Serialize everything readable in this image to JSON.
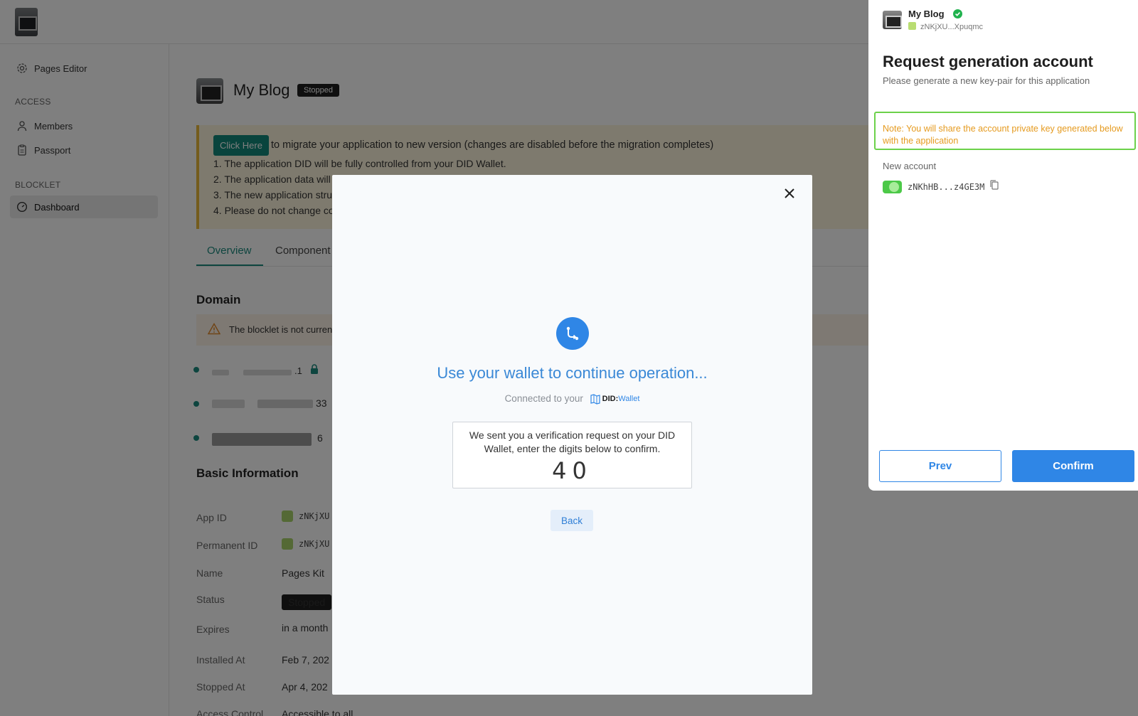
{
  "sidebar": {
    "pages_editor": "Pages Editor",
    "access_heading": "ACCESS",
    "members": "Members",
    "passport": "Passport",
    "blocklet_heading": "BLOCKLET",
    "dashboard": "Dashboard"
  },
  "app": {
    "title": "My Blog",
    "status_badge": "Stopped"
  },
  "migration": {
    "button": "Click Here",
    "text": "to migrate your application to new version (changes are disabled before the migration completes)",
    "lines": [
      "1. The application DID will be fully controlled from your DID Wallet.",
      "2. The application data will",
      "3. The new application stru",
      "4. Please do not change co"
    ]
  },
  "tabs": [
    "Overview",
    "Component"
  ],
  "domain": {
    "heading": "Domain",
    "warning": "The blocklet is not curren",
    "entry_fragments": [
      ".1",
      "33",
      "6"
    ]
  },
  "basic_info": {
    "heading": "Basic Information",
    "rows": [
      {
        "label": "App ID",
        "value": "zNKjXU"
      },
      {
        "label": "Permanent ID",
        "value": "zNKjXU"
      },
      {
        "label": "Name",
        "value": "Pages Kit"
      },
      {
        "label": "Status",
        "value": "Stopped"
      },
      {
        "label": "Expires",
        "value": "in a month"
      },
      {
        "label": "Installed At",
        "value": "Feb 7, 202"
      },
      {
        "label": "Stopped At",
        "value": "Apr 4, 202"
      },
      {
        "label": "Access Control",
        "value": "Accessible to all"
      }
    ]
  },
  "modal": {
    "title": "Use your wallet to continue operation...",
    "connected_prefix": "Connected to your",
    "did_brand": "DID:",
    "did_wallet": "Wallet",
    "verify_text": "We sent you a verification request on your DID Wallet, enter the digits below to confirm.",
    "verify_code": "40",
    "back": "Back",
    "icons": {
      "close": "close-icon",
      "wallet": "wallet-connect-icon"
    }
  },
  "panel": {
    "app_name": "My Blog",
    "app_did": "zNKjXU...Xpuqmc",
    "title": "Request generation account",
    "subtitle": "Please generate a new key-pair for this application",
    "note": "Note: You will share the account private key generated below with the application",
    "new_account_label": "New account",
    "new_account": "zNKhHB...z4GE3M",
    "prev": "Prev",
    "confirm": "Confirm"
  },
  "colors": {
    "accent_blue": "#2f86e6",
    "teal": "#1b8a7e",
    "note_orange": "#e59a1e",
    "note_border": "#6cd14a"
  }
}
